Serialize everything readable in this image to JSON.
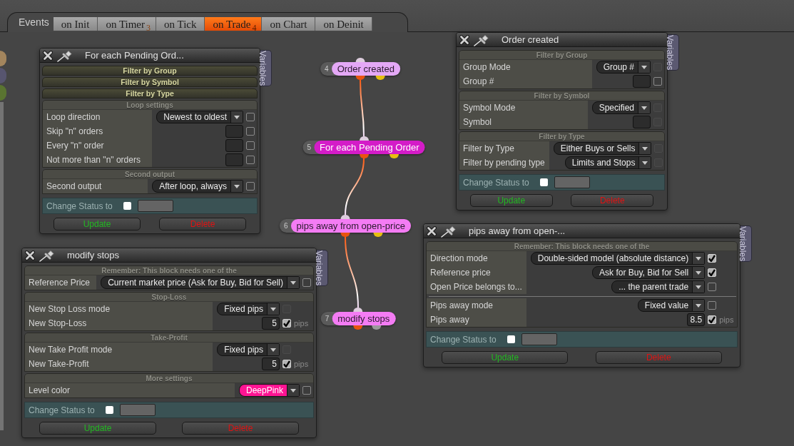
{
  "side_tabs": [
    {
      "color": "#a3855d"
    },
    {
      "color": "#57556f"
    },
    {
      "color": "#5a7431"
    }
  ],
  "header": {
    "title": "Events",
    "tabs": [
      {
        "label": "on Init",
        "selected": false
      },
      {
        "label": "on Timer",
        "count": "3",
        "selected": false
      },
      {
        "label": "on Tick",
        "selected": false
      },
      {
        "label": "on Trade",
        "count": "4",
        "selected": true
      },
      {
        "label": "on Chart",
        "selected": false
      },
      {
        "label": "on Deinit",
        "selected": false
      }
    ]
  },
  "nodes": [
    {
      "number": "4",
      "label": "Order created",
      "color": "#e4a8f6",
      "outputs": [
        {
          "color": "#e8540f"
        },
        {
          "color": "#e6bf10"
        }
      ]
    },
    {
      "number": "5",
      "label": "For each Pending Order",
      "color": "#d41cc8",
      "outputs": [
        {
          "color": "#e8540f"
        },
        {
          "color": "#e6bf10"
        }
      ]
    },
    {
      "number": "6",
      "label": "pips away from open-price",
      "color": "#f47cf4",
      "outputs": [
        {
          "color": "#e8540f"
        },
        {
          "color": "#e6bf10"
        }
      ]
    },
    {
      "number": "7",
      "label": "modify stops",
      "color": "#f47cf4",
      "outputs": [
        {
          "color": "#e8540f"
        },
        {
          "color": "#9a9a9a"
        }
      ]
    }
  ],
  "panels": [
    {
      "title": "For each Pending Ord...",
      "side_tab": "Variables",
      "sections": [
        {
          "title": "Filter by Group",
          "expanded": false
        },
        {
          "title": "Filter by Symbol",
          "expanded": false
        },
        {
          "title": "Filter by Type",
          "expanded": false
        },
        {
          "title": "Loop settings",
          "expanded": true,
          "rows": [
            {
              "label": "Loop direction",
              "control": {
                "kind": "select",
                "value": "Newest to oldest"
              },
              "checkbox": {
                "checked": false,
                "disabled": false
              }
            },
            {
              "label": "Skip \"n\" orders",
              "control": {
                "kind": "input"
              },
              "checkbox": {
                "checked": false,
                "disabled": false
              }
            },
            {
              "label": "Every \"n\" order",
              "control": {
                "kind": "input"
              },
              "checkbox": {
                "checked": false,
                "disabled": false
              }
            },
            {
              "label": "Not more than \"n\" orders",
              "control": {
                "kind": "input"
              },
              "checkbox": {
                "checked": false,
                "disabled": false
              }
            }
          ]
        },
        {
          "title": "Second output",
          "expanded": true,
          "rows": [
            {
              "label": "Second output",
              "control": {
                "kind": "select",
                "value": "After loop, always"
              },
              "checkbox": {
                "checked": false,
                "disabled": false
              }
            }
          ]
        }
      ],
      "status": {
        "label": "Change Status to",
        "checked": false
      },
      "buttons": [
        {
          "label": "Update",
          "kind": "update"
        },
        {
          "label": "Delete",
          "kind": "delete"
        }
      ]
    },
    {
      "title": "Order created",
      "side_tab": "Variables",
      "sections": [
        {
          "title": "Filter by Group",
          "expanded": true,
          "rows": [
            {
              "label": "Group Mode",
              "control": {
                "kind": "select",
                "value": "Group #"
              },
              "checkbox": {
                "checked": false,
                "disabled": true
              }
            },
            {
              "label": "Group #",
              "control": {
                "kind": "input"
              },
              "checkbox": {
                "checked": false,
                "disabled": false
              }
            }
          ]
        },
        {
          "title": "Filter by Symbol",
          "expanded": true,
          "rows": [
            {
              "label": "Symbol Mode",
              "control": {
                "kind": "select",
                "value": "Specified"
              },
              "checkbox": {
                "checked": false,
                "disabled": true
              }
            },
            {
              "label": "Symbol",
              "control": {
                "kind": "input"
              },
              "checkbox": {
                "checked": false,
                "disabled": true
              }
            }
          ]
        },
        {
          "title": "Filter by Type",
          "expanded": true,
          "rows": [
            {
              "label": "Filter by Type",
              "control": {
                "kind": "select",
                "value": "Either Buys or Sells"
              },
              "checkbox": {
                "checked": false,
                "disabled": true
              }
            },
            {
              "label": "Filter by pending type",
              "control": {
                "kind": "select",
                "value": "Limits and Stops"
              },
              "checkbox": {
                "checked": false,
                "disabled": true
              }
            }
          ]
        }
      ],
      "status": {
        "label": "Change Status to",
        "checked": false
      },
      "buttons": [
        {
          "label": "Update",
          "kind": "update"
        },
        {
          "label": "Delete",
          "kind": "delete"
        }
      ]
    },
    {
      "title": "pips away from open-...",
      "side_tab": "Variables",
      "sections": [
        {
          "title": "Remember: This block needs one of the",
          "expanded": true,
          "rows": [
            {
              "label": "Direction mode",
              "control": {
                "kind": "select",
                "value": "Double-sided model (absolute distance)"
              },
              "checkbox": {
                "checked": true,
                "disabled": false
              }
            },
            {
              "label": "Reference price",
              "control": {
                "kind": "select",
                "value": "Ask for Buy, Bid for Sell"
              },
              "checkbox": {
                "checked": true,
                "disabled": false
              }
            },
            {
              "label": "Open Price belongs to...",
              "control": {
                "kind": "select",
                "value": "... the parent trade"
              },
              "checkbox": {
                "checked": false,
                "disabled": false
              }
            },
            {
              "label": "Pips away mode",
              "divider_above": true,
              "control": {
                "kind": "select",
                "value": "Fixed value"
              },
              "checkbox": {
                "checked": false,
                "disabled": false
              }
            },
            {
              "label": "Pips away",
              "control": {
                "kind": "input",
                "value": "8.5"
              },
              "checkbox": {
                "checked": true,
                "disabled": false
              },
              "unit": "pips"
            }
          ]
        }
      ],
      "status": {
        "label": "Change Status to",
        "checked": false
      },
      "buttons": [
        {
          "label": "Update",
          "kind": "update"
        },
        {
          "label": "Delete",
          "kind": "delete"
        }
      ]
    },
    {
      "title": "modify stops",
      "side_tab": "Variables",
      "sections": [
        {
          "title": "Remember: This block needs one of the",
          "expanded": true,
          "rows": [
            {
              "label": "Reference Price",
              "control": {
                "kind": "select",
                "value": "Current market price (Ask for Buy, Bid for Sell)"
              },
              "checkbox": {
                "checked": false,
                "disabled": false
              }
            }
          ]
        },
        {
          "title": "Stop-Loss",
          "expanded": true,
          "rows": [
            {
              "label": "New Stop Loss mode",
              "control": {
                "kind": "select",
                "value": "Fixed pips"
              },
              "checkbox": {
                "checked": false,
                "disabled": true
              }
            },
            {
              "label": "New Stop-Loss",
              "control": {
                "kind": "input",
                "value": "5"
              },
              "checkbox": {
                "checked": true,
                "disabled": false
              },
              "unit": "pips"
            }
          ]
        },
        {
          "title": "Take-Profit",
          "expanded": true,
          "rows": [
            {
              "label": "New Take Profit mode",
              "control": {
                "kind": "select",
                "value": "Fixed pips"
              },
              "checkbox": {
                "checked": false,
                "disabled": true
              }
            },
            {
              "label": "New Take-Profit",
              "control": {
                "kind": "input",
                "value": "5"
              },
              "checkbox": {
                "checked": true,
                "disabled": false
              },
              "unit": "pips"
            }
          ]
        },
        {
          "title": "More settings",
          "expanded": true,
          "rows": [
            {
              "label": "Level color",
              "control": {
                "kind": "select",
                "value": "DeepPink",
                "color": "#ff1493"
              },
              "checkbox": {
                "checked": false,
                "disabled": false
              }
            }
          ]
        }
      ],
      "status": {
        "label": "Change Status to",
        "checked": false
      },
      "buttons": [
        {
          "label": "Update",
          "kind": "update"
        },
        {
          "label": "Delete",
          "kind": "delete"
        }
      ]
    }
  ]
}
